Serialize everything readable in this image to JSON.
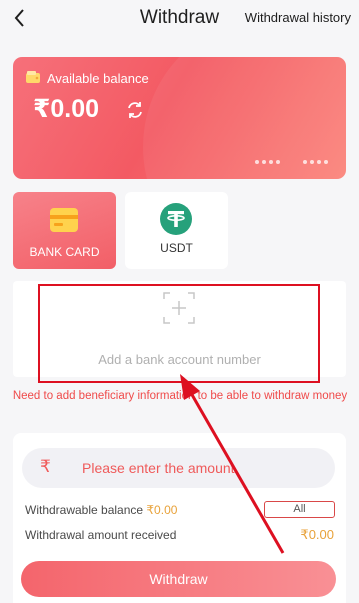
{
  "header": {
    "title": "Withdraw",
    "history_link": "Withdrawal history"
  },
  "balance_card": {
    "label": "Available balance",
    "amount": "₹0.00"
  },
  "payment_methods": [
    {
      "label": "BANK CARD",
      "selected": true
    },
    {
      "label": "USDT",
      "selected": false
    }
  ],
  "bank_account": {
    "add_text": "Add a bank account number",
    "hint": "Need to add beneficiary information to be able to withdraw money"
  },
  "amount": {
    "currency_symbol": "₹",
    "placeholder": "Please enter the amount",
    "withdrawable_label": "Withdrawable balance",
    "withdrawable_value": "₹0.00",
    "all_button": "All",
    "received_label": "Withdrawal amount received",
    "received_value": "₹0.00"
  },
  "actions": {
    "withdraw_label": "Withdraw"
  },
  "colors": {
    "accent": "#f35a63",
    "highlight_annotation": "#dd1021",
    "amount_gold": "#e8a23a"
  }
}
